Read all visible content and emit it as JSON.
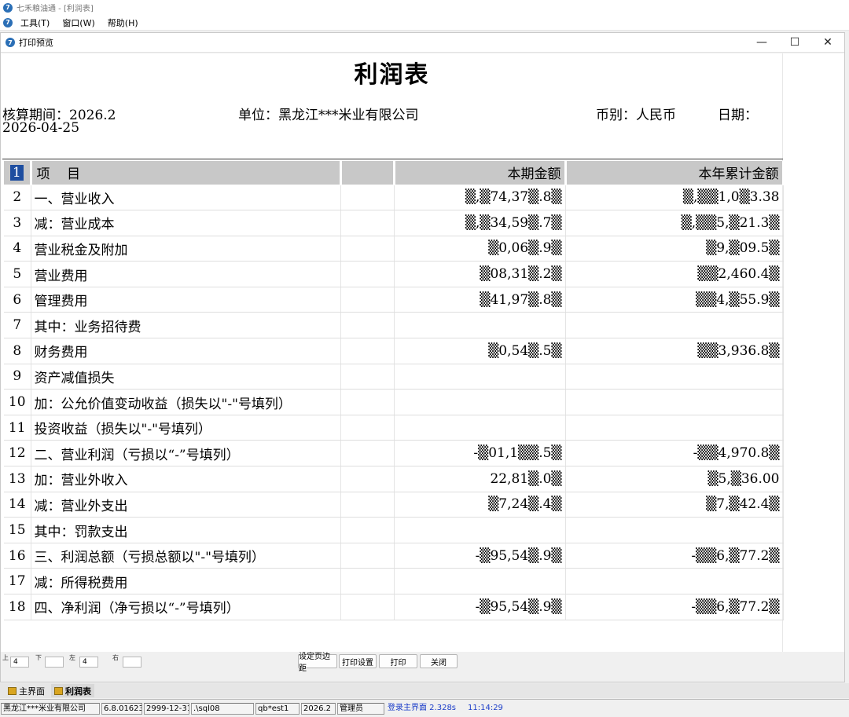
{
  "app": {
    "title": "七禾粮油通 - [利润表]",
    "menu": [
      "工具(T)",
      "窗口(W)",
      "帮助(H)"
    ]
  },
  "dialog": {
    "title": "打印预览",
    "minimize": "—",
    "maximize": "☐",
    "close": "✕"
  },
  "report": {
    "title": "利润表",
    "period": "核算期间：2026.2",
    "unit": "单位：黑龙江***米业有限公司",
    "currency": "币别：人民币",
    "date_label": "日期：",
    "date_value": "2026-04-25",
    "columns": [
      "1",
      "项    目",
      "",
      "本期金额",
      "本年累计金额"
    ],
    "rows": [
      {
        "n": "2",
        "item": "一、营业收入",
        "cur": "▒,▒74,37▒.8▒",
        "ytd": "▒,▒▒1,0▒3.38"
      },
      {
        "n": "3",
        "item": "减：营业成本",
        "cur": "▒,▒34,59▒.7▒",
        "ytd": "▒,▒▒5,▒21.3▒"
      },
      {
        "n": "4",
        "item": "营业税金及附加",
        "cur": "▒0,06▒.9▒",
        "ytd": "▒9,▒09.5▒"
      },
      {
        "n": "5",
        "item": "营业费用",
        "cur": "▒08,31▒.2▒",
        "ytd": "▒▒2,460.4▒"
      },
      {
        "n": "6",
        "item": "管理费用",
        "cur": "▒41,97▒.8▒",
        "ytd": "▒▒4,▒55.9▒"
      },
      {
        "n": "7",
        "item": "其中：业务招待费",
        "cur": "",
        "ytd": ""
      },
      {
        "n": "8",
        "item": "财务费用",
        "cur": "▒0,54▒.5▒",
        "ytd": "▒▒3,936.8▒"
      },
      {
        "n": "9",
        "item": "资产减值损失",
        "cur": "",
        "ytd": ""
      },
      {
        "n": "10",
        "item": "加：公允价值变动收益（损失以\"-\"号填列）",
        "cur": "",
        "ytd": ""
      },
      {
        "n": "11",
        "item": "投资收益（损失以\"-\"号填列）",
        "cur": "",
        "ytd": ""
      },
      {
        "n": "12",
        "item": "二、营业利润（亏损以“-”号填列）",
        "cur": "-▒01,1▒▒.5▒",
        "ytd": "-▒▒4,970.8▒"
      },
      {
        "n": "13",
        "item": "加：营业外收入",
        "cur": "22,81▒.0▒",
        "ytd": "▒5,▒36.00"
      },
      {
        "n": "14",
        "item": "减：营业外支出",
        "cur": "▒7,24▒.4▒",
        "ytd": "▒7,▒42.4▒"
      },
      {
        "n": "15",
        "item": "其中：罚款支出",
        "cur": "",
        "ytd": ""
      },
      {
        "n": "16",
        "item": "三、利润总额（亏损总额以\"-\"号填列）",
        "cur": "-▒95,54▒.9▒",
        "ytd": "-▒▒6,▒77.2▒"
      },
      {
        "n": "17",
        "item": "减：所得税费用",
        "cur": "",
        "ytd": ""
      },
      {
        "n": "18",
        "item": "四、净利润（净亏损以“-”号填列）",
        "cur": "-▒95,54▒.9▒",
        "ytd": "-▒▒6,▒77.2▒"
      }
    ]
  },
  "margins": {
    "top_label": "上",
    "top_value": "4",
    "bottom_label": "下",
    "bottom_value": "",
    "left_label": "左",
    "left_value": "4",
    "right_label": "右",
    "right_value": ""
  },
  "buttons": {
    "set_margin": "设定页边距",
    "print_setup": "打印设置",
    "print": "打印",
    "close": "关闭"
  },
  "tabs": [
    "主界面",
    "利润表"
  ],
  "statusbar": {
    "company": "黑龙江***米业有限公司",
    "version": "6.8.01623",
    "expire": "2999-12-31",
    "server": ".\\sql08",
    "db": "qb*est1",
    "period": "2026.2",
    "user": "管理员",
    "login": "登录主界面 2.328s",
    "time": "11:14:29"
  }
}
